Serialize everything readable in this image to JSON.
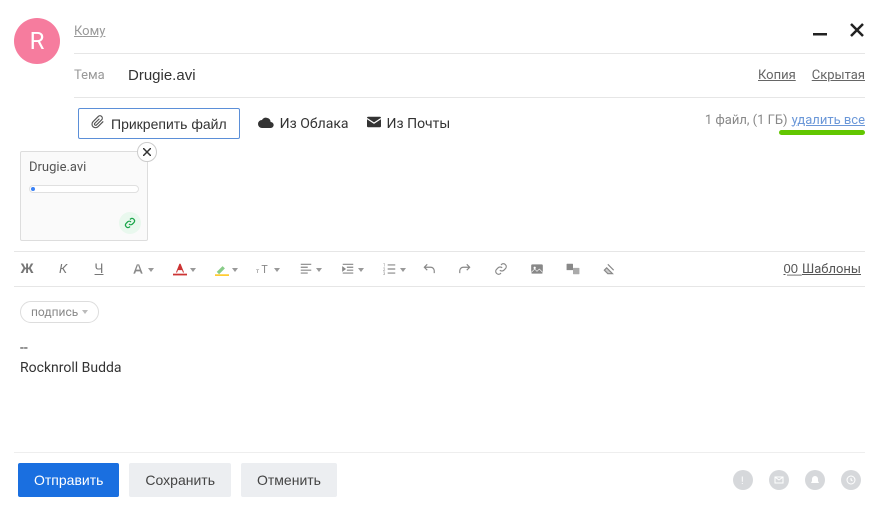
{
  "avatar_initial": "R",
  "fields": {
    "to_label": "Кому",
    "to_value": "",
    "subject_label": "Тема",
    "subject_value": "Drugie.avi",
    "copy_label": "Копия",
    "bcc_label": "Скрытая"
  },
  "attach": {
    "button_label": "Прикрепить файл",
    "from_cloud": "Из Облака",
    "from_mail": "Из Почты",
    "status_count": "1 файл, (1 ГБ)",
    "remove_all": "удалить все"
  },
  "attachment": {
    "filename": "Drugie.avi"
  },
  "toolbar": {
    "bold": "Ж",
    "italic": "К",
    "underline": "Ч",
    "templates_label": "Шаблоны"
  },
  "signature": {
    "chip_label": "подпись",
    "sep": "--",
    "name": "Rocknroll Budda"
  },
  "footer": {
    "send": "Отправить",
    "save": "Сохранить",
    "cancel": "Отменить"
  }
}
